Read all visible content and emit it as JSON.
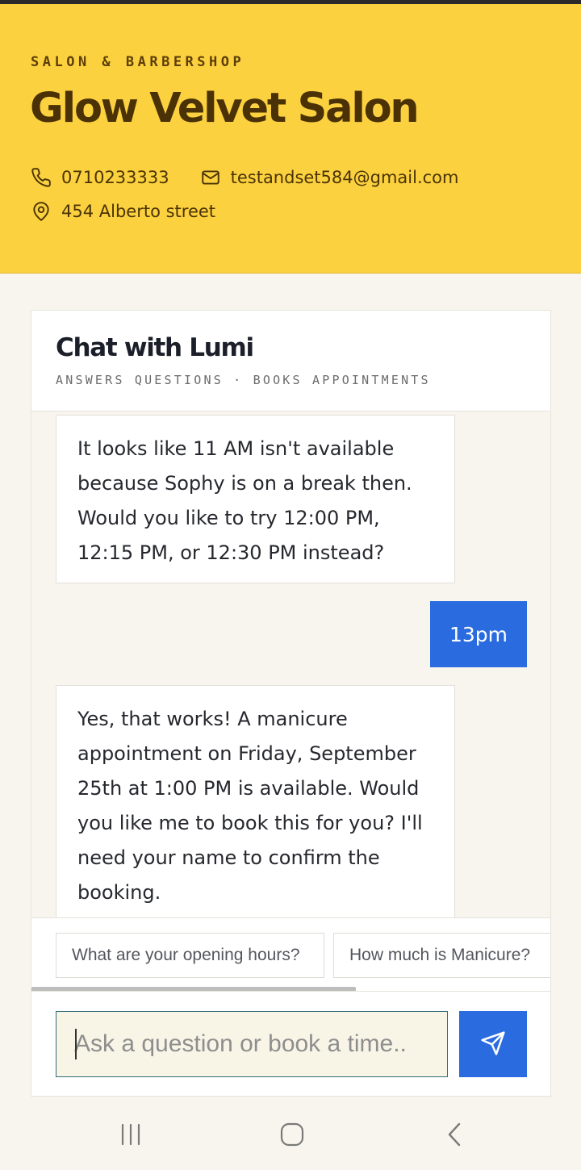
{
  "header": {
    "kicker": "SALON & BARBERSHOP",
    "name": "Glow Velvet Salon",
    "phone": "0710233333",
    "email": "testandset584@gmail.com",
    "address": "454 Alberto street",
    "bg_color": "#fcd13f"
  },
  "chat": {
    "title": "Chat with Lumi",
    "subtitle": "ANSWERS QUESTIONS · BOOKS APPOINTMENTS",
    "messages": [
      {
        "from": "bot",
        "text": "It looks like 11 AM isn't available because Sophy is on a break then. Would you like to try 12:00 PM, 12:15 PM, or 12:30 PM instead?"
      },
      {
        "from": "user",
        "text": "13pm"
      },
      {
        "from": "bot",
        "text": "Yes, that works! A manicure appointment on Friday, September 25th at 1:00 PM is available. Would you like me to book this for you? I'll need your name to confirm the booking."
      }
    ],
    "suggestions": [
      "What are your opening hours?",
      "How much is Manicure?"
    ],
    "input_placeholder": "Ask a question or book a time..",
    "accent_color": "#2a6be0"
  },
  "icons": {
    "phone": "phone-icon",
    "email": "mail-icon",
    "address": "map-pin-icon",
    "send": "send-icon",
    "nav_recent": "recent-apps-icon",
    "nav_home": "home-icon",
    "nav_back": "back-icon"
  }
}
